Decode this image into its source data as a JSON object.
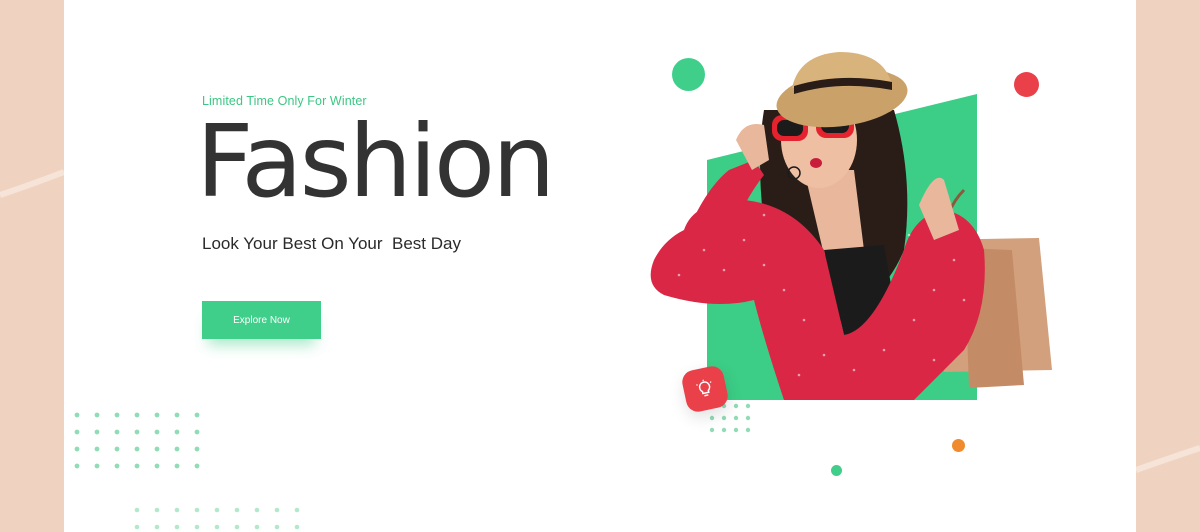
{
  "hero": {
    "eyebrow": "Limited Time Only For Winter",
    "headline": "Fashion",
    "tagline": "Look Your Best On Your  Best Day",
    "cta_label": "Explore Now"
  },
  "images": {
    "hero_model": "woman-in-red-polka-dot-dress-with-sunglasses-hat-and-shopping-bag"
  },
  "icons": {
    "badge": "lightbulb-icon"
  },
  "colors": {
    "accent_green": "#3fcf8a",
    "accent_red": "#e9404a",
    "accent_orange": "#f08a2c",
    "page_background": "#efd3c0",
    "headline_text": "#333333"
  }
}
